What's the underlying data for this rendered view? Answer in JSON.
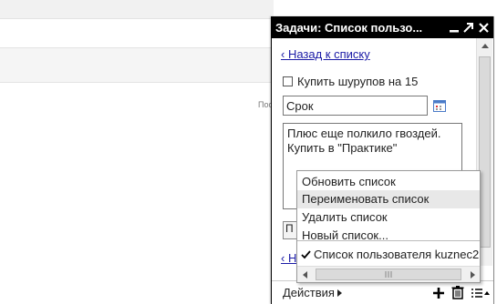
{
  "background": {
    "cut_text": "Пос"
  },
  "window": {
    "title": "Задачи: Список пользо..."
  },
  "back_link": "‹ Назад к списку",
  "task": {
    "label": "Купить шурупов на 15",
    "date_value": "Срок",
    "notes": "Плюс еще полкило гвоздей. Купить в \"Практике\"",
    "hidden_button": "П",
    "hidden_link": "‹ На"
  },
  "menu": {
    "items": [
      {
        "label": "Обновить список"
      },
      {
        "label": "Переименовать список"
      },
      {
        "label": "Удалить список"
      },
      {
        "label": "Новый список..."
      }
    ],
    "current_list": "Список пользователя kuznec2"
  },
  "footer": {
    "actions_label": "Действия"
  },
  "colors": {
    "titlebar": "#000000",
    "link": "#1a1aa6",
    "menu_highlight": "#e8e8e8"
  }
}
